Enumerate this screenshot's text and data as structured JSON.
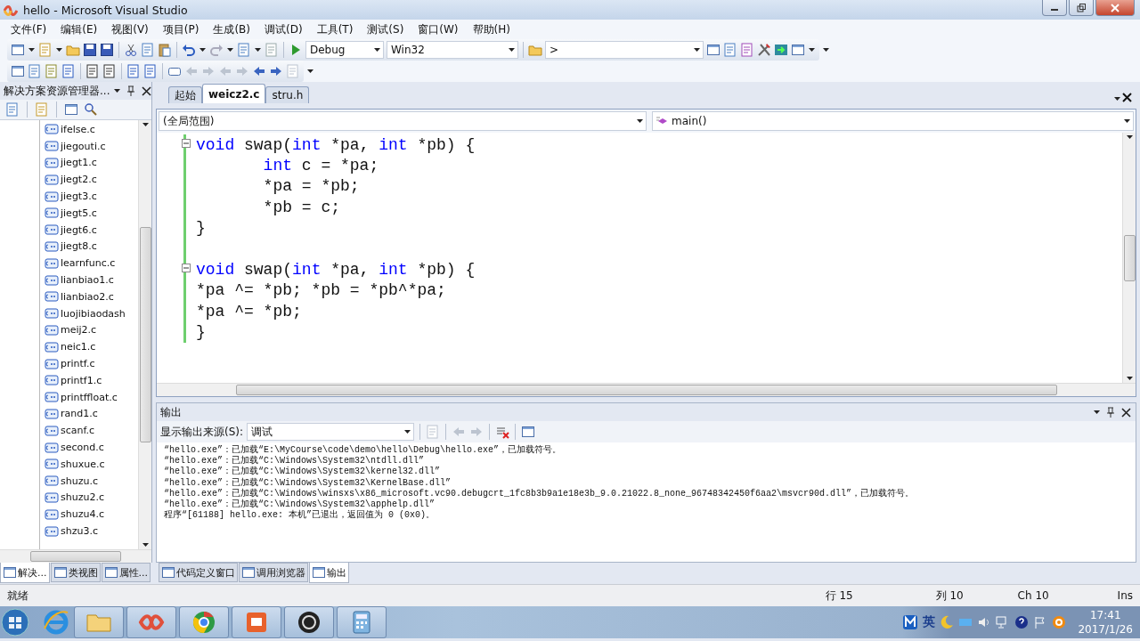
{
  "window": {
    "title": "hello - Microsoft Visual Studio"
  },
  "menu": [
    "文件(F)",
    "编辑(E)",
    "视图(V)",
    "项目(P)",
    "生成(B)",
    "调试(D)",
    "工具(T)",
    "测试(S)",
    "窗口(W)",
    "帮助(H)"
  ],
  "toolbar": {
    "configuration": "Debug",
    "platform": "Win32",
    "find": ">"
  },
  "solution_explorer": {
    "title": "解决方案资源管理器...",
    "files": [
      "ifelse.c",
      "jiegouti.c",
      "jiegt1.c",
      "jiegt2.c",
      "jiegt3.c",
      "jiegt5.c",
      "jiegt6.c",
      "jiegt8.c",
      "learnfunc.c",
      "lianbiao1.c",
      "lianbiao2.c",
      "luojibiaodash",
      "meij2.c",
      "neic1.c",
      "printf.c",
      "printf1.c",
      "printffloat.c",
      "rand1.c",
      "scanf.c",
      "second.c",
      "shuxue.c",
      "shuzu.c",
      "shuzu2.c",
      "shuzu4.c",
      "shzu3.c"
    ]
  },
  "editor": {
    "tabs": [
      {
        "label": "起始",
        "selected": false
      },
      {
        "label": "weicz2.c",
        "selected": true
      },
      {
        "label": "stru.h",
        "selected": false
      }
    ],
    "scope": "(全局范围)",
    "member": "main()",
    "lines": [
      {
        "fold": true,
        "indent": false,
        "tokens": [
          {
            "kind": "keyword",
            "text": "void"
          },
          {
            "kind": "plain",
            "text": " swap("
          },
          {
            "kind": "keyword",
            "text": "int"
          },
          {
            "kind": "plain",
            "text": " *pa, "
          },
          {
            "kind": "keyword",
            "text": "int"
          },
          {
            "kind": "plain",
            "text": " *pb) {"
          }
        ]
      },
      {
        "fold": false,
        "indent": true,
        "tokens": [
          {
            "kind": "keyword",
            "text": "int"
          },
          {
            "kind": "plain",
            "text": " c = *pa;"
          }
        ]
      },
      {
        "fold": false,
        "indent": true,
        "tokens": [
          {
            "kind": "plain",
            "text": "*pa = *pb;"
          }
        ]
      },
      {
        "fold": false,
        "indent": true,
        "tokens": [
          {
            "kind": "plain",
            "text": "*pb = c;"
          }
        ]
      },
      {
        "fold": false,
        "tokens": [
          {
            "kind": "plain",
            "text": "}"
          }
        ]
      },
      {
        "fold": false
      },
      {
        "fold": true,
        "tokens": [
          {
            "kind": "keyword",
            "text": "void"
          },
          {
            "kind": "plain",
            "text": " swap("
          },
          {
            "kind": "keyword",
            "text": "int"
          },
          {
            "kind": "plain",
            "text": " *pa, "
          },
          {
            "kind": "keyword",
            "text": "int"
          },
          {
            "kind": "plain",
            "text": " *pb) {"
          }
        ]
      },
      {
        "fold": false,
        "tokens": [
          {
            "kind": "plain",
            "text": "*pa ^= *pb; *pb = *pb^*pa;"
          }
        ]
      },
      {
        "fold": false,
        "tokens": [
          {
            "kind": "plain",
            "text": "*pa ^= *pb;"
          }
        ]
      },
      {
        "fold": false,
        "tokens": [
          {
            "kind": "plain",
            "text": "}"
          }
        ]
      }
    ]
  },
  "output": {
    "title": "输出",
    "source_label": "显示输出来源(S):",
    "source": "调试",
    "lines": [
      "“hello.exe”：已加载“E:\\MyCourse\\code\\demo\\hello\\Debug\\hello.exe”，已加载符号。",
      "“hello.exe”：已加载“C:\\Windows\\System32\\ntdll.dll”",
      "“hello.exe”：已加载“C:\\Windows\\System32\\kernel32.dll”",
      "“hello.exe”：已加载“C:\\Windows\\System32\\KernelBase.dll”",
      "“hello.exe”：已加载“C:\\Windows\\winsxs\\x86_microsoft.vc90.debugcrt_1fc8b3b9a1e18e3b_9.0.21022.8_none_96748342450f6aa2\\msvcr90d.dll”，已加载符号。",
      "“hello.exe”：已加载“C:\\Windows\\System32\\apphelp.dll”",
      "程序“[61188] hello.exe: 本机”已退出，返回值为 0 (0x0)。"
    ]
  },
  "left_tabs": [
    {
      "label": "解决...",
      "selected": true
    },
    {
      "label": "类视图",
      "selected": false
    },
    {
      "label": "属性...",
      "selected": false
    }
  ],
  "bottom_tabs": [
    {
      "label": "代码定义窗口",
      "selected": false
    },
    {
      "label": "调用浏览器",
      "selected": false
    },
    {
      "label": "输出",
      "selected": true
    }
  ],
  "status_bar": {
    "message": "就绪",
    "line": "行 15",
    "column": "列 10",
    "char": "Ch 10",
    "mode": "Ins"
  },
  "taskbar": {
    "ime": "英",
    "time": "17:41",
    "date": "2017/1/26"
  }
}
